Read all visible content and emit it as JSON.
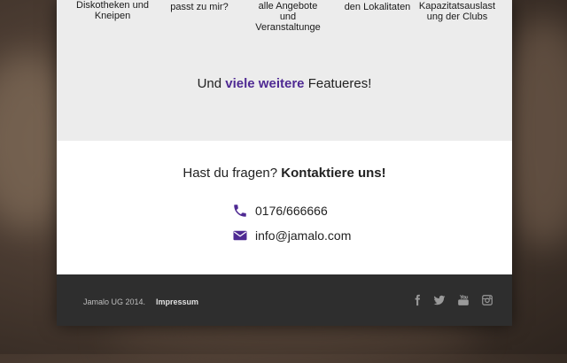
{
  "features": {
    "columns": [
      {
        "lines": [
          "Diskotheken und",
          "Kneipen"
        ]
      },
      {
        "lines": [
          "passt zu mir?"
        ]
      },
      {
        "lines": [
          "alle Angebote",
          "und",
          "Veranstaltunge"
        ]
      },
      {
        "lines": [
          "den Lokalitaten"
        ]
      },
      {
        "lines": [
          "Kapazitatsauslast",
          "ung der Clubs"
        ]
      }
    ],
    "more_prefix": "Und",
    "more_highlight": "viele weitere",
    "more_suffix": "Featueres!"
  },
  "contact": {
    "title_prefix": "Hast du fragen?",
    "title_bold": "Kontaktiere uns!",
    "phone": "0176/666666",
    "email": "info@jamalo.com",
    "phone_icon": "phone-icon",
    "email_icon": "envelope-icon"
  },
  "footer": {
    "copyright": "Jamalo UG 2014.",
    "imprint": "Impressum",
    "social_icons": [
      "facebook-icon",
      "twitter-icon",
      "youtube-icon",
      "instagram-icon"
    ]
  },
  "colors": {
    "accent": "#4f2a93",
    "footer_bg": "#2e2e2e",
    "features_bg": "#ececec"
  }
}
